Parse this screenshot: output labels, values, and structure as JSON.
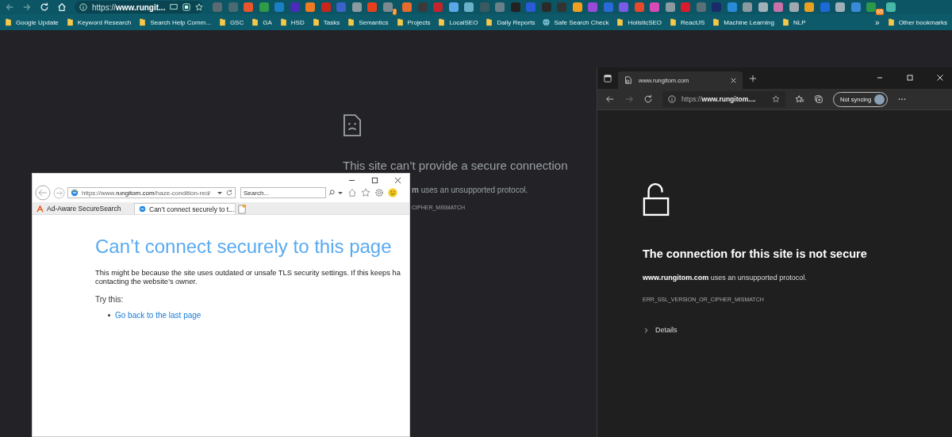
{
  "chrome": {
    "address": "https://**www.rungit...**",
    "extensions": [
      {
        "color": "#5a6a70"
      },
      {
        "color": "#4a6a72"
      },
      {
        "color": "#e8542c"
      },
      {
        "color": "#2e9b48"
      },
      {
        "color": "#1a7fc4"
      },
      {
        "color": "#4b2bb8"
      },
      {
        "color": "#f07a22"
      },
      {
        "color": "#c8261c"
      },
      {
        "color": "#3a62c8"
      },
      {
        "color": "#8a9aa0"
      },
      {
        "color": "#e8401c"
      },
      {
        "color": "#7a8a90",
        "badge": "2"
      },
      {
        "color": "#e86a2c"
      },
      {
        "color": "#3a3a3a"
      },
      {
        "color": "#c4242c"
      },
      {
        "color": "#5aa8e8"
      },
      {
        "color": "#6ab0c8"
      },
      {
        "color": "#3a5a62"
      },
      {
        "color": "#6a8088"
      },
      {
        "color": "#222222"
      },
      {
        "color": "#2a5ad8"
      },
      {
        "color": "#2a2a2a"
      },
      {
        "color": "#333333"
      },
      {
        "color": "#f0a020"
      },
      {
        "color": "#9a4ad8"
      },
      {
        "color": "#2a6ad8"
      },
      {
        "color": "#7a5ae8"
      },
      {
        "color": "#e8482c"
      },
      {
        "color": "#d84ab8"
      },
      {
        "color": "#8a9aa0"
      },
      {
        "color": "#d81c2c"
      },
      {
        "color": "#5a7078"
      },
      {
        "color": "#1a2a6a"
      },
      {
        "color": "#2a8ad8"
      },
      {
        "color": "#8a9aa0"
      },
      {
        "color": "#a0b0b8"
      },
      {
        "color": "#c870a8"
      },
      {
        "color": "#a0a8b0"
      },
      {
        "color": "#e8a020"
      },
      {
        "color": "#1a6ad8"
      },
      {
        "color": "#a0b0b8"
      },
      {
        "color": "#3a8ad8"
      },
      {
        "color": "#2a9a48",
        "badge": "65"
      },
      {
        "color": "#48b8a8"
      }
    ],
    "bookmarks": [
      {
        "label": "Google Update",
        "kind": "folder"
      },
      {
        "label": "Keyword Research",
        "kind": "folder"
      },
      {
        "label": "Search Help Comm...",
        "kind": "folder"
      },
      {
        "label": "GSC",
        "kind": "folder"
      },
      {
        "label": "GA",
        "kind": "folder"
      },
      {
        "label": "HSD",
        "kind": "folder"
      },
      {
        "label": "Tasks",
        "kind": "folder"
      },
      {
        "label": "Semantics",
        "kind": "folder"
      },
      {
        "label": "Projects",
        "kind": "folder"
      },
      {
        "label": "LocalSEO",
        "kind": "folder"
      },
      {
        "label": "Daily Reports",
        "kind": "folder"
      },
      {
        "label": "Safe Search Check",
        "kind": "page"
      },
      {
        "label": "HolisticSEO",
        "kind": "folder"
      },
      {
        "label": "ReactJS",
        "kind": "folder"
      },
      {
        "label": "Machine Learning",
        "kind": "folder"
      },
      {
        "label": "NLP",
        "kind": "folder"
      }
    ],
    "more": "»",
    "other_bookmarks": "Other bookmarks",
    "error": {
      "title": "This site can’t provide a secure connection",
      "message": "**m** uses an unsupported protocol.",
      "code": "CIPHER_MISMATCH"
    }
  },
  "ie": {
    "address": "https://www.**rungitom.com**/haze-condition-red/",
    "search": {
      "placeholder": "Search..."
    },
    "tabs": [
      {
        "label": "Ad-Aware SecureSearch",
        "selected": false
      },
      {
        "label": "Can’t connect securely to t...",
        "selected": true
      }
    ],
    "title": "Can’t connect securely to this page",
    "lines": [
      "This might be because the site uses outdated or unsafe TLS security settings. If this keeps ha",
      "contacting the website’s owner."
    ],
    "try": "Try this:",
    "link": "Go back to the last page"
  },
  "edge": {
    "tab": "www.rungitom.com",
    "address": "https://**www.rungitom....**",
    "sync": "Not syncing",
    "title": "The connection for this site is not secure",
    "message": "**www.rungitom.com** uses an unsupported protocol.",
    "code": "ERR_SSL_VERSION_OR_CIPHER_MISMATCH",
    "details": {
      "label": "Details",
      "expanded": false
    }
  }
}
